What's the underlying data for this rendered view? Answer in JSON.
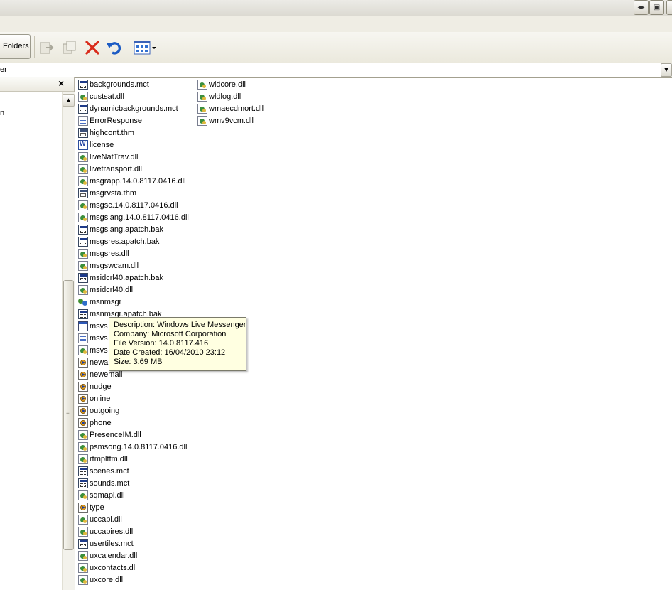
{
  "toolbar": {
    "folders_label": "Folders",
    "icons": [
      "move-to-icon",
      "copy-to-icon",
      "delete-icon",
      "undo-icon",
      "views-icon"
    ]
  },
  "address": {
    "partial_text": "er"
  },
  "folders_pane": {
    "close_glyph": "×",
    "partial_text": "n"
  },
  "files": [
    {
      "name": "backgrounds.mct",
      "type": "mct"
    },
    {
      "name": "custsat.dll",
      "type": "dll"
    },
    {
      "name": "dynamicbackgrounds.mct",
      "type": "mct"
    },
    {
      "name": "ErrorResponse",
      "type": "txt"
    },
    {
      "name": "highcont.thm",
      "type": "thm"
    },
    {
      "name": "license",
      "type": "doc"
    },
    {
      "name": "liveNatTrav.dll",
      "type": "dll"
    },
    {
      "name": "livetransport.dll",
      "type": "dll"
    },
    {
      "name": "msgrapp.14.0.8117.0416.dll",
      "type": "dll"
    },
    {
      "name": "msgrvsta.thm",
      "type": "thm"
    },
    {
      "name": "msgsc.14.0.8117.0416.dll",
      "type": "dll"
    },
    {
      "name": "msgslang.14.0.8117.0416.dll",
      "type": "dll"
    },
    {
      "name": "msgslang.apatch.bak",
      "type": "mct"
    },
    {
      "name": "msgsres.apatch.bak",
      "type": "mct"
    },
    {
      "name": "msgsres.dll",
      "type": "dll"
    },
    {
      "name": "msgswcam.dll",
      "type": "dll"
    },
    {
      "name": "msidcrl40.apatch.bak",
      "type": "mct"
    },
    {
      "name": "msidcrl40.dll",
      "type": "dll"
    },
    {
      "name": "msnmsgr",
      "type": "exe"
    },
    {
      "name": "msnmsgr.apatch.bak",
      "type": "mct"
    },
    {
      "name": "msvs",
      "type": "win"
    },
    {
      "name": "msvs",
      "type": "txt"
    },
    {
      "name": "msvs",
      "type": "dll"
    },
    {
      "name": "newa",
      "type": "wav"
    },
    {
      "name": "newemail",
      "type": "wav"
    },
    {
      "name": "nudge",
      "type": "wav"
    },
    {
      "name": "online",
      "type": "wav"
    },
    {
      "name": "outgoing",
      "type": "wav"
    },
    {
      "name": "phone",
      "type": "wav"
    },
    {
      "name": "PresenceIM.dll",
      "type": "dll"
    },
    {
      "name": "psmsong.14.0.8117.0416.dll",
      "type": "dll"
    },
    {
      "name": "rtmpltfm.dll",
      "type": "dll"
    },
    {
      "name": "scenes.mct",
      "type": "mct"
    },
    {
      "name": "sounds.mct",
      "type": "mct"
    },
    {
      "name": "sqmapi.dll",
      "type": "dll"
    },
    {
      "name": "type",
      "type": "wav"
    },
    {
      "name": "uccapi.dll",
      "type": "dll"
    },
    {
      "name": "uccapires.dll",
      "type": "dll"
    },
    {
      "name": "usertiles.mct",
      "type": "mct"
    },
    {
      "name": "uxcalendar.dll",
      "type": "dll"
    },
    {
      "name": "uxcontacts.dll",
      "type": "dll"
    },
    {
      "name": "uxcore.dll",
      "type": "dll"
    }
  ],
  "files_col2": [
    {
      "name": "wldcore.dll",
      "type": "dll"
    },
    {
      "name": "wldlog.dll",
      "type": "dll"
    },
    {
      "name": "wmaecdmort.dll",
      "type": "dll"
    },
    {
      "name": "wmv9vcm.dll",
      "type": "dll"
    }
  ],
  "tooltip": {
    "description": "Description: Windows Live Messenger",
    "company": "Company: Microsoft Corporation",
    "file_version": "File Version: 14.0.8117.416",
    "date_created": "Date Created: 16/04/2010 23:12",
    "size": "Size: 3.69 MB"
  }
}
